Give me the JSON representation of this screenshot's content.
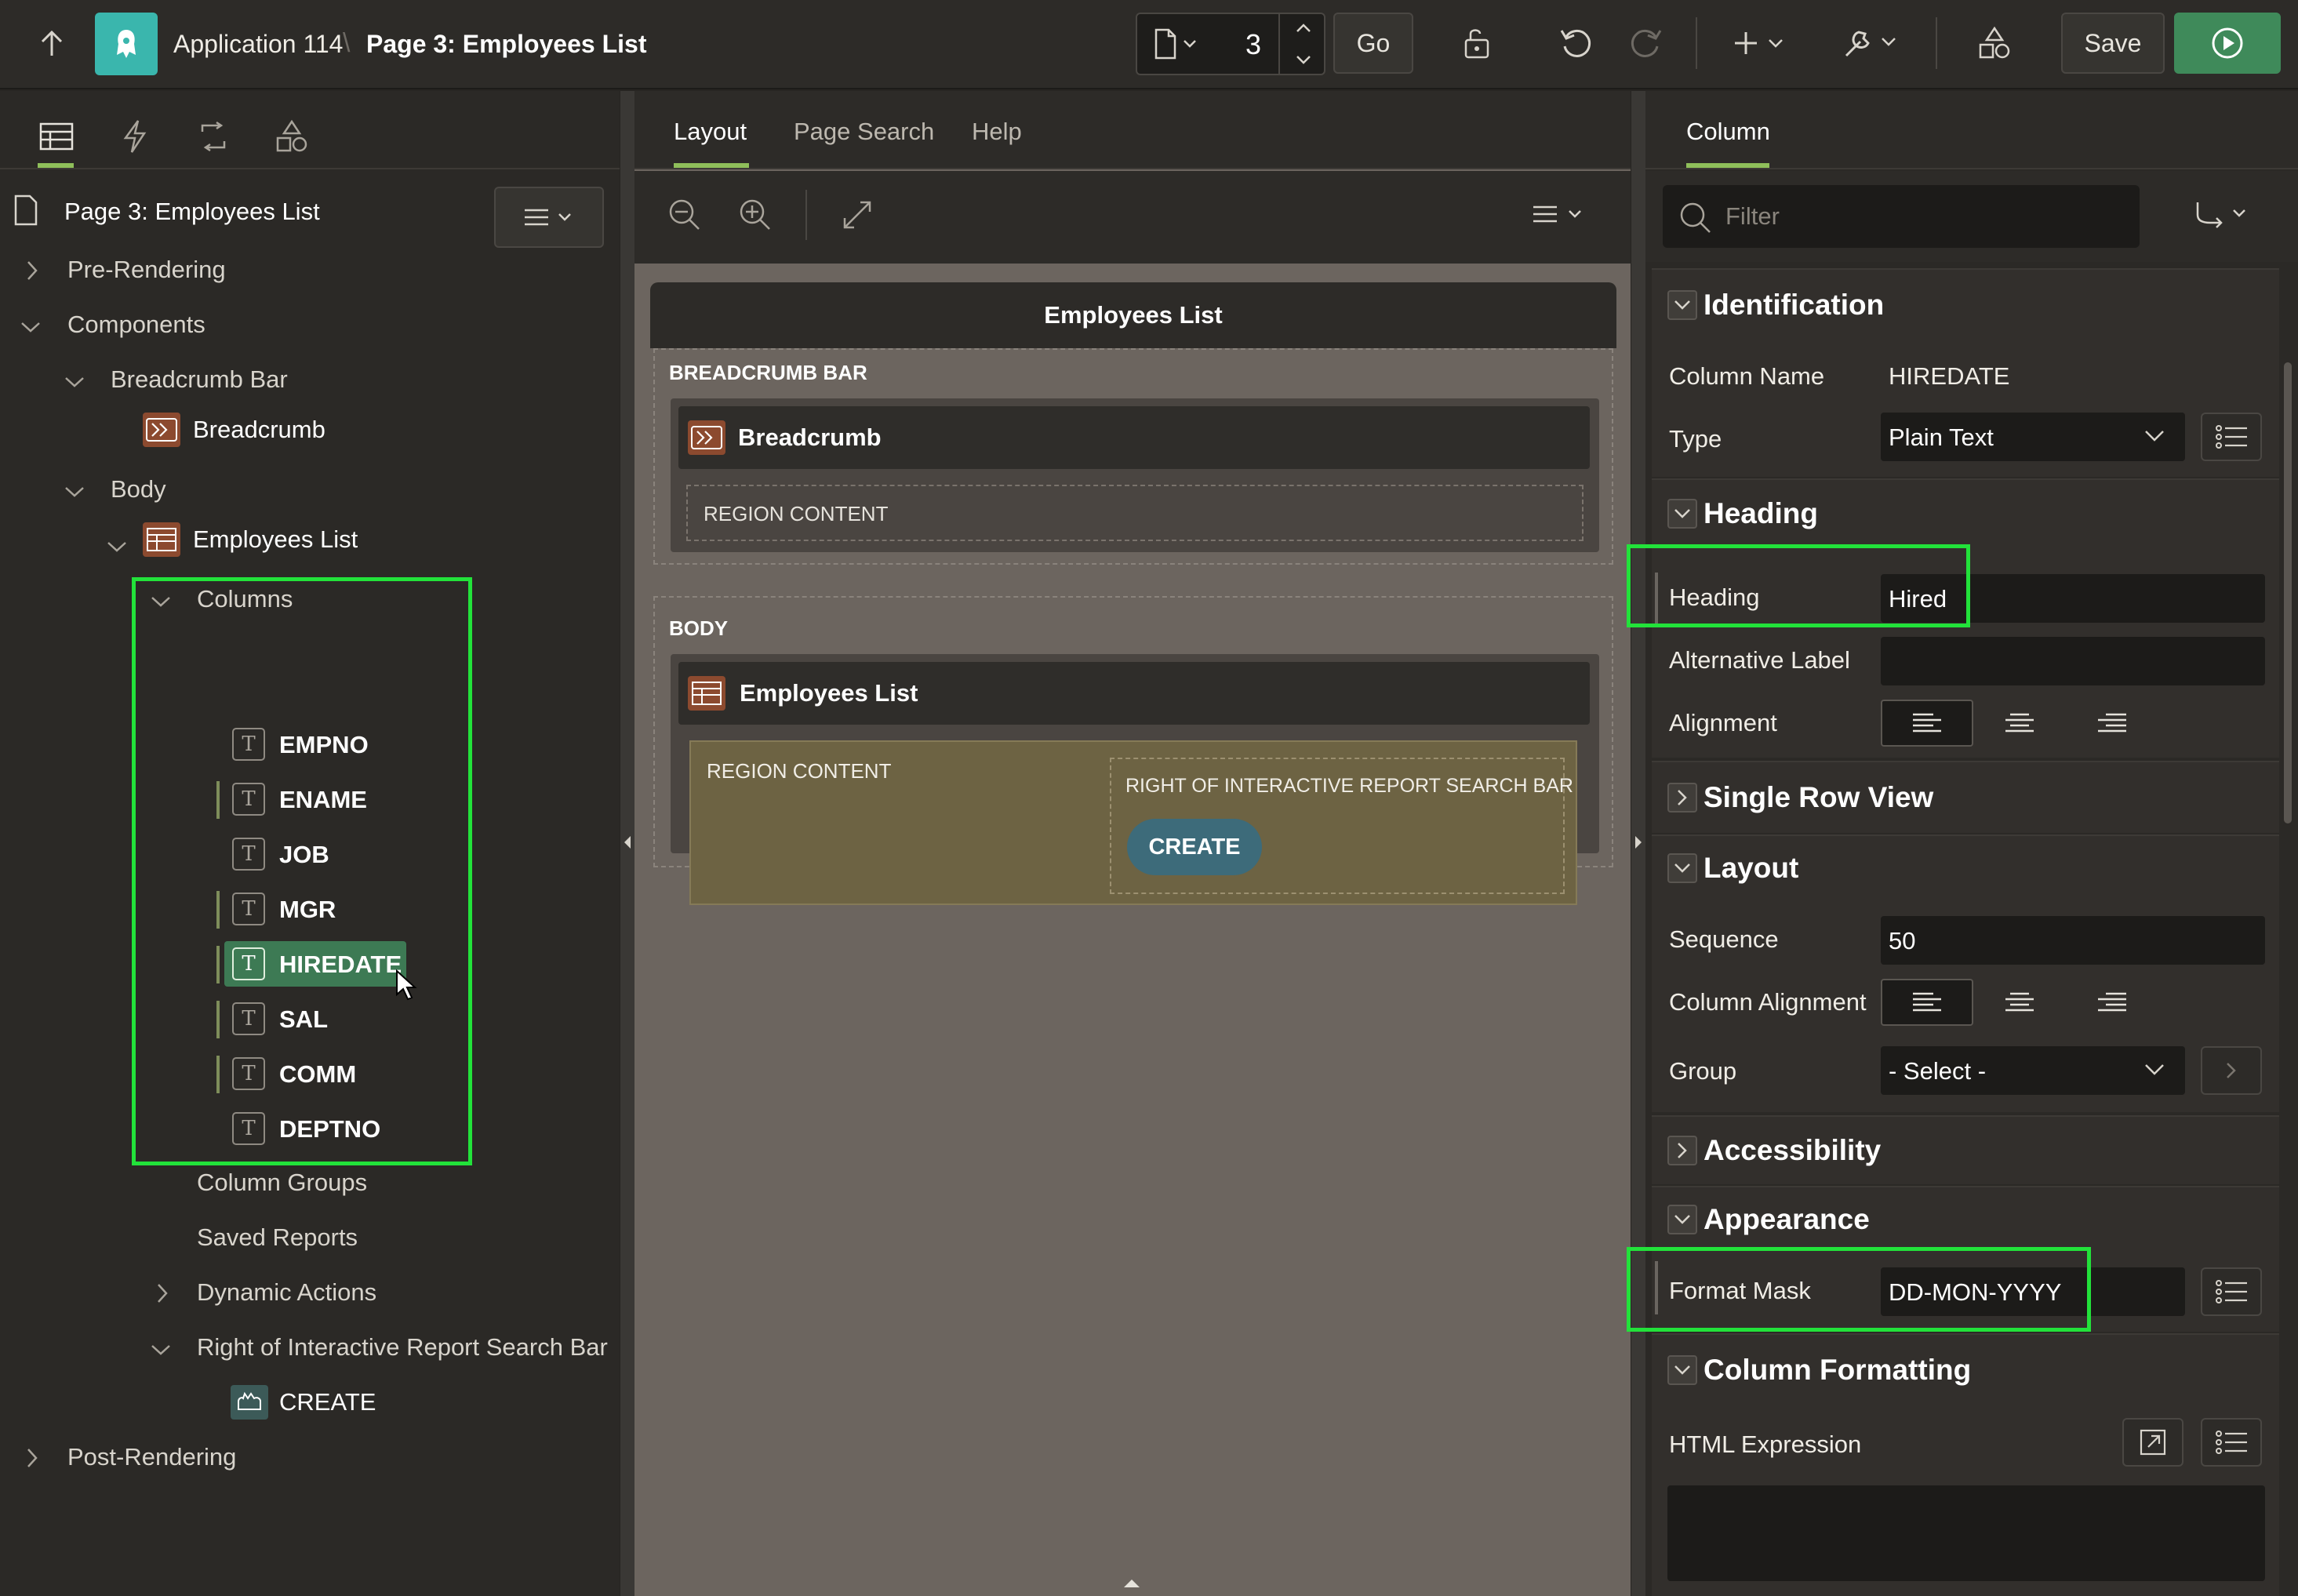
{
  "topbar": {
    "app_name": "Application 114",
    "separator": "\\",
    "page_title": "Page 3: Employees List",
    "page_number": "3",
    "go_label": "Go",
    "save_label": "Save"
  },
  "left": {
    "page_node": "Page 3: Employees List",
    "tree": {
      "pre_rendering": "Pre-Rendering",
      "components": "Components",
      "breadcrumb_bar": "Breadcrumb Bar",
      "breadcrumb": "Breadcrumb",
      "body": "Body",
      "employees_list": "Employees List",
      "columns": "Columns",
      "column_items": [
        "EMPNO",
        "ENAME",
        "JOB",
        "MGR",
        "HIREDATE",
        "SAL",
        "COMM",
        "DEPTNO"
      ],
      "column_groups": "Column Groups",
      "saved_reports": "Saved Reports",
      "dynamic_actions": "Dynamic Actions",
      "right_of_search_bar": "Right of Interactive Report Search Bar",
      "create": "CREATE",
      "post_rendering": "Post-Rendering"
    }
  },
  "center": {
    "tabs": [
      "Layout",
      "Page Search",
      "Help"
    ],
    "page_region_title": "Employees List",
    "breadcrumb_bar_label": "BREADCRUMB BAR",
    "breadcrumb_region": "Breadcrumb",
    "region_content": "REGION CONTENT",
    "body_label": "BODY",
    "employees_region": "Employees List",
    "region_content_2": "REGION CONTENT",
    "right_of_search_label": "RIGHT OF INTERACTIVE REPORT SEARCH BAR",
    "create_button": "CREATE"
  },
  "right": {
    "tab": "Column",
    "filter_placeholder": "Filter",
    "identification": {
      "title": "Identification",
      "column_name_label": "Column Name",
      "column_name_value": "HIREDATE",
      "type_label": "Type",
      "type_value": "Plain Text"
    },
    "heading": {
      "title": "Heading",
      "heading_label": "Heading",
      "heading_value": "Hired",
      "alt_label": "Alternative Label",
      "alt_value": "",
      "alignment_label": "Alignment"
    },
    "single_row_view": {
      "title": "Single Row View"
    },
    "layout": {
      "title": "Layout",
      "sequence_label": "Sequence",
      "sequence_value": "50",
      "column_alignment_label": "Column Alignment",
      "group_label": "Group",
      "group_value": "- Select -"
    },
    "accessibility": {
      "title": "Accessibility"
    },
    "appearance": {
      "title": "Appearance",
      "format_mask_label": "Format Mask",
      "format_mask_value": "DD-MON-YYYY"
    },
    "column_formatting": {
      "title": "Column Formatting",
      "html_expression_label": "HTML Expression",
      "html_expression_value": ""
    }
  },
  "colors": {
    "highlight_green": "#22e23a",
    "selected_node": "#3d7a54",
    "run_button": "#3f8a5a",
    "app_icon": "#3ab6ad",
    "create_button": "#3d6b7a"
  }
}
